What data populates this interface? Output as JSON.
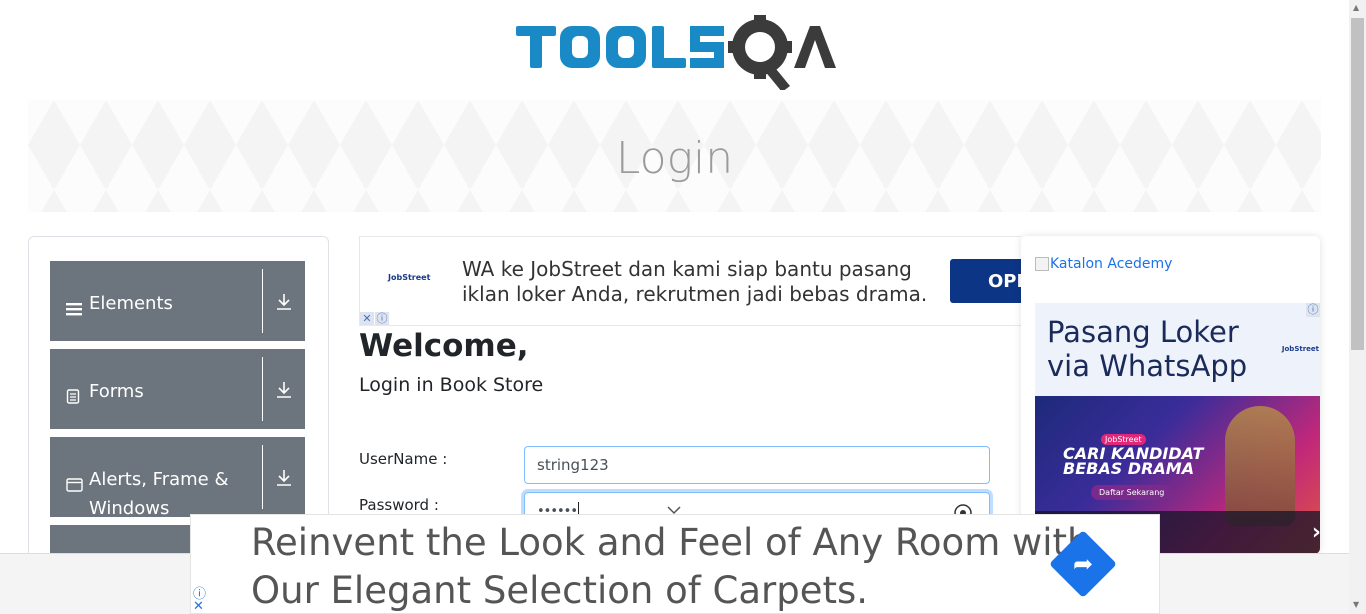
{
  "brand": {
    "logo_text": "TOOLSQA",
    "primary_color": "#1a8ac6",
    "dark_color": "#3b3b3b"
  },
  "banner": {
    "title": "Login"
  },
  "sidebar": {
    "groups": [
      {
        "label": "Elements",
        "icon": "hamburger-icon"
      },
      {
        "label": "Forms",
        "icon": "document-icon"
      },
      {
        "label": "Alerts, Frame & Windows",
        "icon": "window-icon"
      }
    ]
  },
  "top_ad": {
    "text_line1": "WA ke JobStreet dan kami siap bantu pasang",
    "text_line2": "iklan loker Anda, rekrutmen jadi bebas drama.",
    "cta": "OPE",
    "brand": "JobStreet"
  },
  "login": {
    "welcome": "Welcome,",
    "subtitle": "Login in Book Store",
    "username_label": "UserName :",
    "username_value": "string123",
    "password_label": "Password :",
    "password_value": "••••••"
  },
  "right_ads": {
    "katalon_alt": "Katalon Acedemy",
    "headline_line1": "Pasang Loker",
    "headline_line2": "via WhatsApp",
    "brand": "JobStreet",
    "image_text_line1": "CARI KANDIDAT",
    "image_text_line2": "BEBAS DRAMA",
    "badge": "JobStreet",
    "button": "Daftar Sekarang"
  },
  "bottom_ad": {
    "line1": "Reinvent the Look and Feel of Any Room with",
    "line2": "Our Elegant Selection of Carpets."
  }
}
